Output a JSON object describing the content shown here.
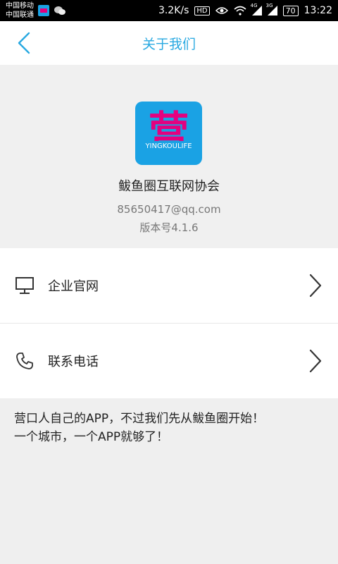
{
  "status_bar": {
    "carrier_1": "中国移动",
    "carrier_2": "中国联通",
    "net_speed": "3.2K/s",
    "hd_badge": "HD",
    "signal_4g": "4G",
    "signal_3g": "3G",
    "battery": "70",
    "time": "13:22"
  },
  "header": {
    "title": "关于我们"
  },
  "about": {
    "logo_char": "营",
    "logo_text": "YINGKOULIFE",
    "app_name": "鲅鱼圈互联网协会",
    "email": "85650417@qq.com",
    "version": "版本号4.1.6"
  },
  "menu": {
    "items": [
      {
        "label": "企业官网",
        "icon": "monitor-icon"
      },
      {
        "label": "联系电话",
        "icon": "phone-icon"
      }
    ]
  },
  "description": {
    "line1": "营口人自己的APP，不过我们先从鲅鱼圈开始！",
    "line2": "一个城市，一个APP就够了！"
  },
  "colors": {
    "accent": "#29a9e1",
    "logo_bg": "#1aa2e4",
    "logo_char": "#e4007f"
  }
}
